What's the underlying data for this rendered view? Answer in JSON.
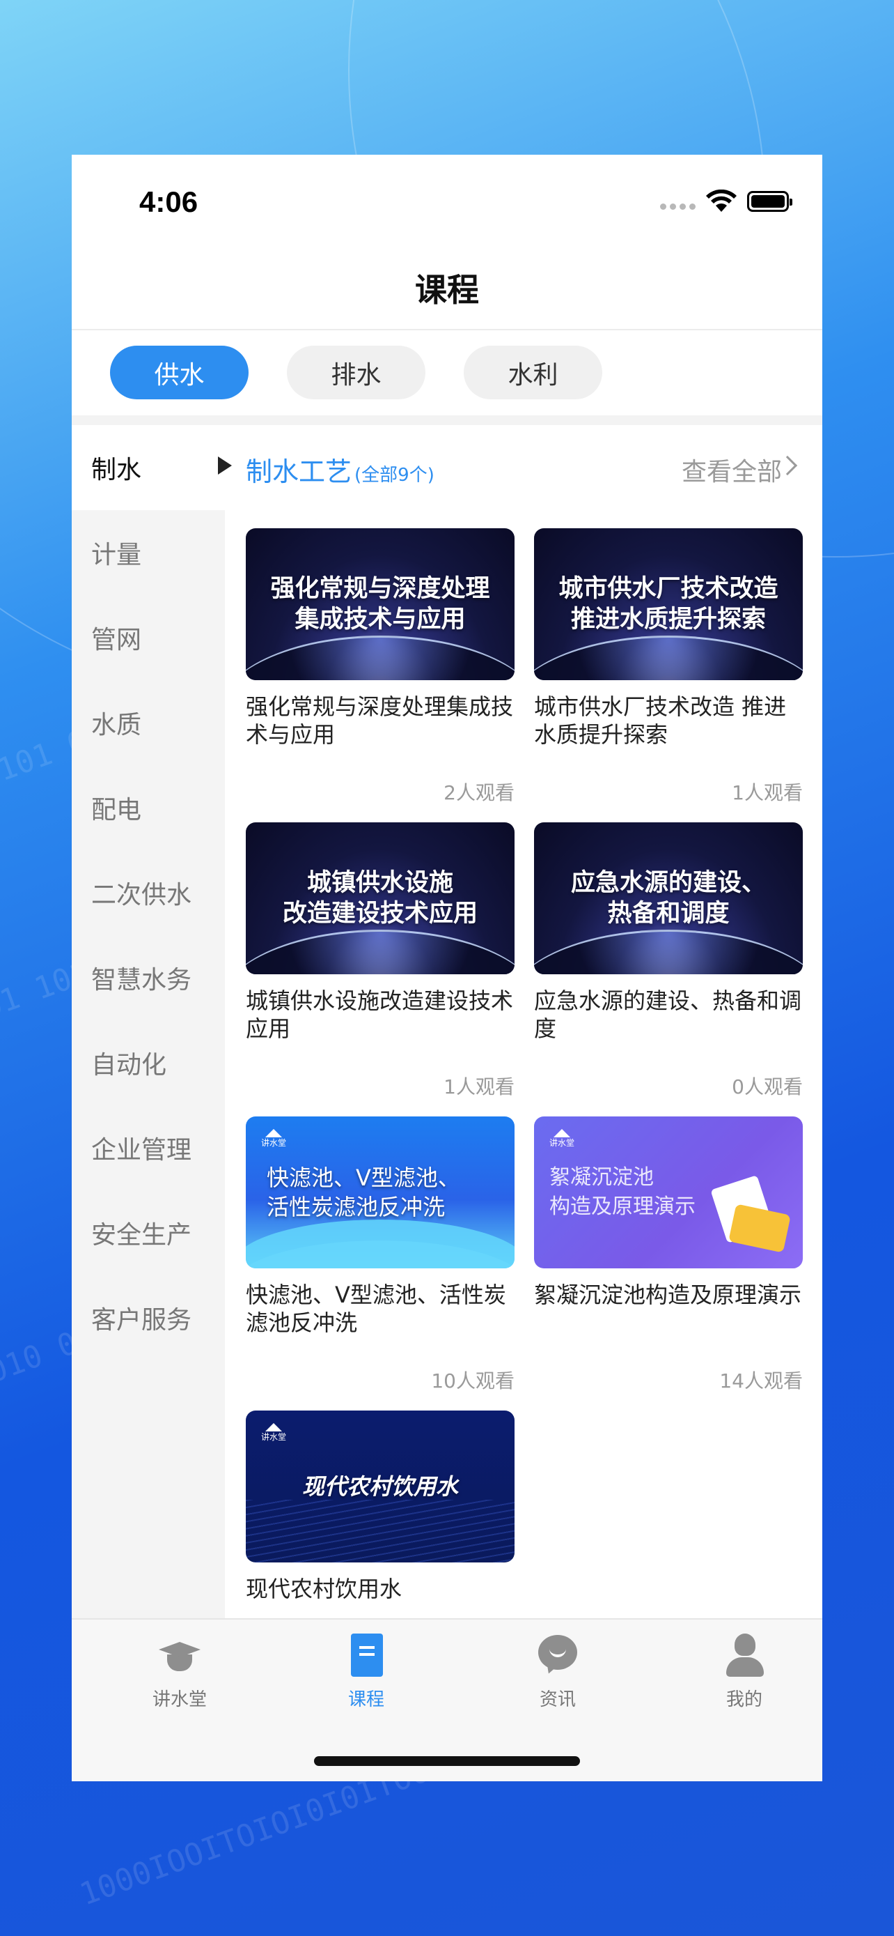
{
  "status_bar": {
    "time": "4:06"
  },
  "header": {
    "title": "课程"
  },
  "category_tabs": [
    {
      "label": "供水",
      "active": true
    },
    {
      "label": "排水",
      "active": false
    },
    {
      "label": "水利",
      "active": false
    }
  ],
  "sidebar": {
    "items": [
      {
        "label": "制水",
        "active": true
      },
      {
        "label": "计量"
      },
      {
        "label": "管网"
      },
      {
        "label": "水质"
      },
      {
        "label": "配电"
      },
      {
        "label": "二次供水"
      },
      {
        "label": "智慧水务"
      },
      {
        "label": "自动化"
      },
      {
        "label": "企业管理"
      },
      {
        "label": "安全生产"
      },
      {
        "label": "客户服务"
      }
    ]
  },
  "section": {
    "title": "制水工艺",
    "count": "(全部9个)",
    "view_all": "查看全部"
  },
  "courses": [
    {
      "thumb_text_1": "强化常规与深度处理",
      "thumb_text_2": "集成技术与应用",
      "title": "强化常规与深度处理集成技术与应用",
      "views": "2人观看",
      "style": "space"
    },
    {
      "thumb_text_1": "城市供水厂技术改造",
      "thumb_text_2": "推进水质提升探索",
      "title": "城市供水厂技术改造 推进水质提升探索",
      "views": "1人观看",
      "style": "space"
    },
    {
      "thumb_text_1": "城镇供水设施",
      "thumb_text_2": "改造建设技术应用",
      "title": "城镇供水设施改造建设技术应用",
      "views": "1人观看",
      "style": "space"
    },
    {
      "thumb_text_1": "应急水源的建设、",
      "thumb_text_2": "热备和调度",
      "title": "应急水源的建设、热备和调度",
      "views": "0人观看",
      "style": "space"
    },
    {
      "thumb_text_1": "快滤池、V型滤池、",
      "thumb_text_2": "活性炭滤池反冲洗",
      "title": "快滤池、V型滤池、活性炭滤池反冲洗",
      "views": "10人观看",
      "style": "blue-wave",
      "logo": "讲水堂"
    },
    {
      "thumb_text_1": "絮凝沉淀池",
      "thumb_text_2": "构造及原理演示",
      "title": "絮凝沉淀池构造及原理演示",
      "views": "14人观看",
      "style": "purple",
      "logo": "讲水堂"
    },
    {
      "thumb_text_1": "现代农村饮用水",
      "thumb_text_2": "",
      "title": "现代农村饮用水",
      "views": "",
      "style": "navy",
      "logo": "讲水堂"
    }
  ],
  "tabbar": {
    "items": [
      {
        "label": "讲水堂",
        "icon": "graduation-cap-icon",
        "active": false
      },
      {
        "label": "课程",
        "icon": "book-icon",
        "active": true
      },
      {
        "label": "资讯",
        "icon": "chat-bubble-icon",
        "active": false
      },
      {
        "label": "我的",
        "icon": "user-icon",
        "active": false
      }
    ]
  },
  "colors": {
    "accent": "#2d8ef0",
    "background_gradient_end": "#1457e0"
  }
}
